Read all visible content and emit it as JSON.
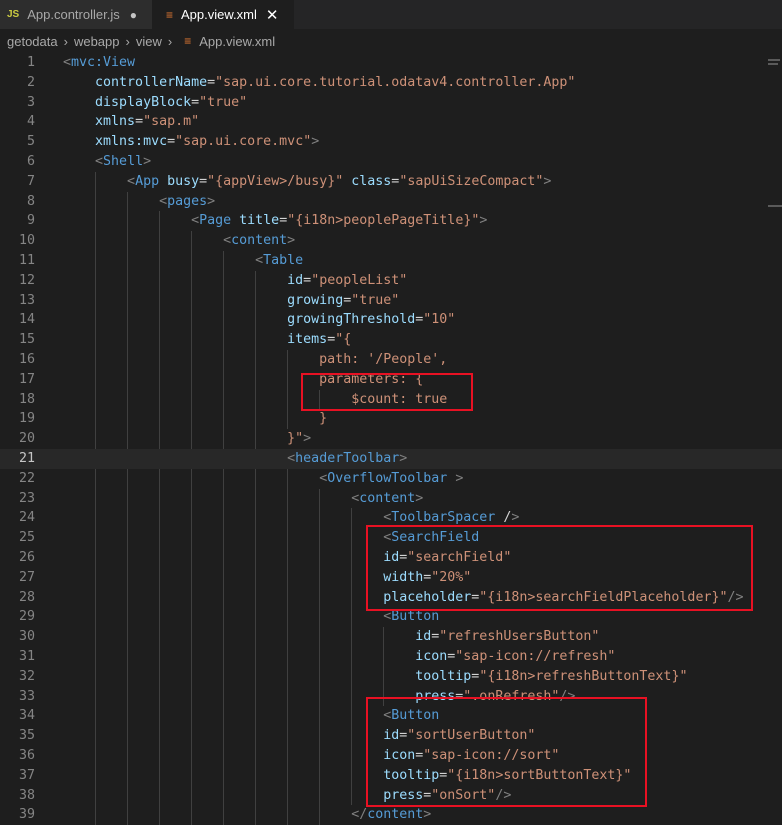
{
  "tabs": [
    {
      "label": "App.controller.js",
      "icon": "JS",
      "state": "modified"
    },
    {
      "label": "App.view.xml",
      "icon": "rss-icon",
      "state": "active"
    }
  ],
  "breadcrumb": [
    "getodata",
    "webapp",
    "view",
    "App.view.xml"
  ],
  "editor": {
    "current_line": 21,
    "lines": [
      {
        "n": "1",
        "code": "<mvc:View"
      },
      {
        "n": "2",
        "code": "    controllerName=\"sap.ui.core.tutorial.odatav4.controller.App\""
      },
      {
        "n": "3",
        "code": "    displayBlock=\"true\""
      },
      {
        "n": "4",
        "code": "    xmlns=\"sap.m\""
      },
      {
        "n": "5",
        "code": "    xmlns:mvc=\"sap.ui.core.mvc\">"
      },
      {
        "n": "6",
        "code": "    <Shell>"
      },
      {
        "n": "7",
        "code": "        <App busy=\"{appView>/busy}\" class=\"sapUiSizeCompact\">"
      },
      {
        "n": "8",
        "code": "            <pages>"
      },
      {
        "n": "9",
        "code": "                <Page title=\"{i18n>peoplePageTitle}\">"
      },
      {
        "n": "10",
        "code": "                    <content>"
      },
      {
        "n": "11",
        "code": "                        <Table"
      },
      {
        "n": "12",
        "code": "                            id=\"peopleList\""
      },
      {
        "n": "13",
        "code": "                            growing=\"true\""
      },
      {
        "n": "14",
        "code": "                            growingThreshold=\"10\""
      },
      {
        "n": "15",
        "code": "                            items=\"{"
      },
      {
        "n": "16",
        "code": "                                path: '/People',"
      },
      {
        "n": "17",
        "code": "                                parameters: {"
      },
      {
        "n": "18",
        "code": "                                    $count: true"
      },
      {
        "n": "19",
        "code": "                                }"
      },
      {
        "n": "20",
        "code": "                            }\">"
      },
      {
        "n": "21",
        "code": "                            <headerToolbar>"
      },
      {
        "n": "22",
        "code": "                                <OverflowToolbar >"
      },
      {
        "n": "23",
        "code": "                                    <content>"
      },
      {
        "n": "24",
        "code": "                                        <ToolbarSpacer />"
      },
      {
        "n": "25",
        "code": "                                        <SearchField"
      },
      {
        "n": "26",
        "code": "                                        id=\"searchField\""
      },
      {
        "n": "27",
        "code": "                                        width=\"20%\""
      },
      {
        "n": "28",
        "code": "                                        placeholder=\"{i18n>searchFieldPlaceholder}\"/>"
      },
      {
        "n": "29",
        "code": "                                        <Button"
      },
      {
        "n": "30",
        "code": "                                            id=\"refreshUsersButton\""
      },
      {
        "n": "31",
        "code": "                                            icon=\"sap-icon://refresh\""
      },
      {
        "n": "32",
        "code": "                                            tooltip=\"{i18n>refreshButtonText}\""
      },
      {
        "n": "33",
        "code": "                                            press=\".onRefresh\"/>"
      },
      {
        "n": "34",
        "code": "                                        <Button"
      },
      {
        "n": "35",
        "code": "                                        id=\"sortUserButton\""
      },
      {
        "n": "36",
        "code": "                                        icon=\"sap-icon://sort\""
      },
      {
        "n": "37",
        "code": "                                        tooltip=\"{i18n>sortButtonText}\""
      },
      {
        "n": "38",
        "code": "                                        press=\"onSort\"/>"
      },
      {
        "n": "39",
        "code": "                                    </content>"
      }
    ]
  },
  "colors": {
    "background": "#1e1e1e",
    "tag": "#569cd6",
    "attribute": "#9cdcfe",
    "string": "#ce9178",
    "highlight_box": "#e81123"
  }
}
